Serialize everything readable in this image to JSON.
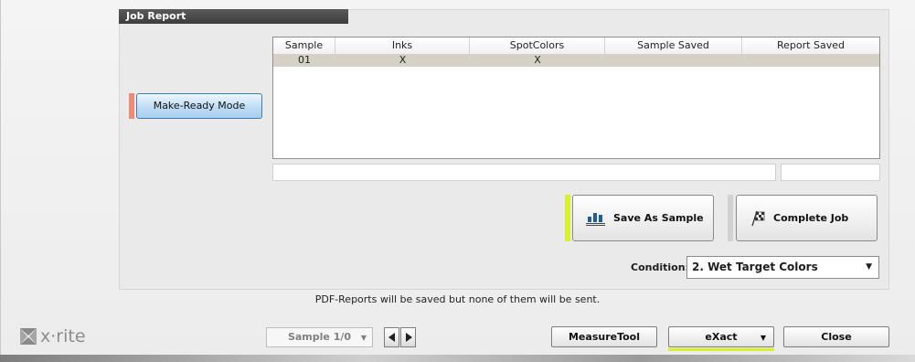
{
  "panel": {
    "title": "Job Report"
  },
  "mode": {
    "label": "Make-Ready Mode"
  },
  "table": {
    "columns": [
      "Sample",
      "Inks",
      "SpotColors",
      "Sample Saved",
      "Report Saved"
    ],
    "rows": [
      {
        "sample": "01",
        "inks": "X",
        "spot_colors": "X",
        "sample_saved": "",
        "report_saved": ""
      }
    ]
  },
  "actions": {
    "save_as_sample": "Save As Sample",
    "complete_job": "Complete Job"
  },
  "condition": {
    "label": "Condition:",
    "value": "2. Wet Target Colors"
  },
  "footer": {
    "message": "PDF-Reports will be saved but none of them will be sent.",
    "sample_select": "Sample 1/0",
    "measure_tool": "MeasureTool",
    "exact": "eXact",
    "close": "Close"
  },
  "brand": {
    "logo_text": "x·rite"
  },
  "colors": {
    "accent": "#d7f22b",
    "mode_marker": "#f08a78",
    "title_bar": "#3d3d3d",
    "selected_row": "#d6d1c6"
  },
  "icons": {
    "save_as_sample": "bar-chart-icon",
    "complete_job": "checkered-flag-icon",
    "condition_dropdown": "chevron-down-icon",
    "sample_dropdown": "chevron-down-icon",
    "prev": "arrow-left-icon",
    "next": "arrow-right-icon",
    "logo": "xrite-logo-icon"
  }
}
